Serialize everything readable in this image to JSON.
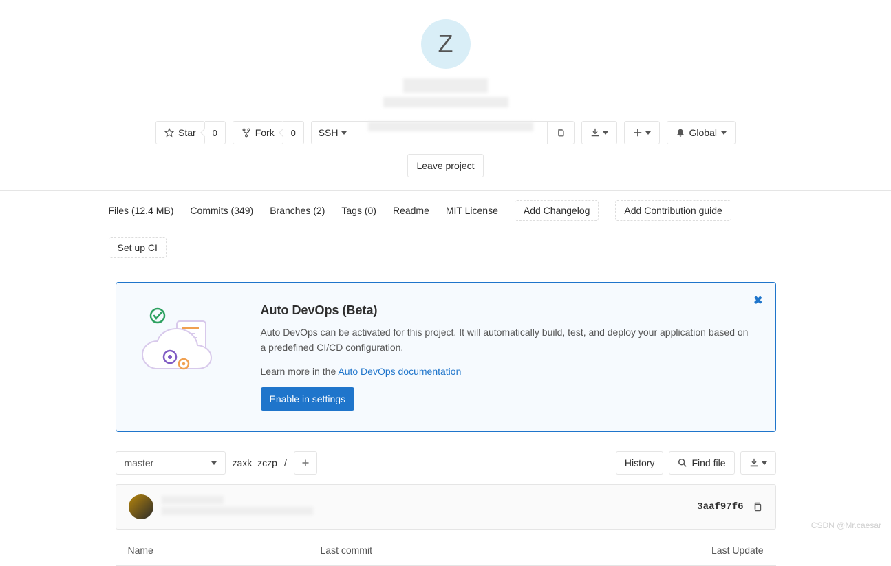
{
  "avatar_letter": "Z",
  "actions": {
    "star": "Star",
    "star_count": "0",
    "fork": "Fork",
    "fork_count": "0",
    "clone_protocol": "SSH",
    "global": "Global",
    "leave": "Leave project"
  },
  "stats": {
    "files": "Files (12.4 MB)",
    "commits": "Commits (349)",
    "branches": "Branches (2)",
    "tags": "Tags (0)",
    "readme": "Readme",
    "license": "MIT License",
    "add_changelog": "Add Changelog",
    "add_contrib": "Add Contribution guide",
    "setup_ci": "Set up CI"
  },
  "devops": {
    "title": "Auto DevOps (Beta)",
    "description": "Auto DevOps can be activated for this project. It will automatically build, test, and deploy your application based on a predefined CI/CD configuration.",
    "learn_prefix": "Learn more in the ",
    "learn_link": "Auto DevOps documentation",
    "enable": "Enable in settings"
  },
  "repo": {
    "branch": "master",
    "breadcrumb_root": "zaxk_zczp",
    "breadcrumb_sep": "/",
    "history": "History",
    "find_file": "Find file",
    "commit_sha": "3aaf97f6"
  },
  "table": {
    "name": "Name",
    "last_commit": "Last commit",
    "last_update": "Last Update"
  },
  "watermark": "CSDN @Mr.caesar"
}
